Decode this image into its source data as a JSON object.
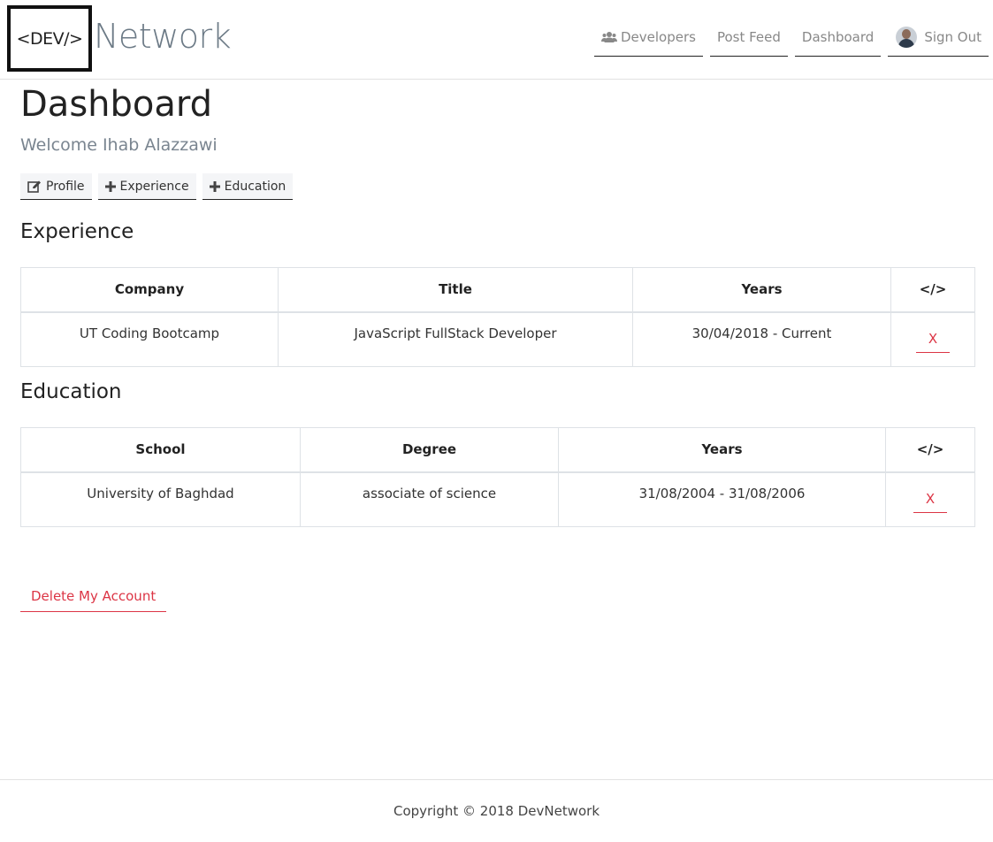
{
  "brand": {
    "logo_text": "<DEV/>",
    "name": "Network"
  },
  "nav": {
    "developers": "Developers",
    "post_feed": "Post Feed",
    "dashboard": "Dashboard",
    "sign_out": "Sign Out"
  },
  "page": {
    "title": "Dashboard",
    "welcome": "Welcome Ihab Alazzawi"
  },
  "actions": {
    "profile": "Profile",
    "experience": "Experience",
    "education": "Education"
  },
  "experience": {
    "heading": "Experience",
    "columns": [
      "Company",
      "Title",
      "Years",
      "</>"
    ],
    "rows": [
      {
        "company": "UT Coding Bootcamp",
        "title": "JavaScript FullStack Developer",
        "years": "30/04/2018 - Current",
        "delete_label": "X"
      }
    ]
  },
  "education": {
    "heading": "Education",
    "columns": [
      "School",
      "Degree",
      "Years",
      "</>"
    ],
    "rows": [
      {
        "school": "University of Baghdad",
        "degree": "associate of science",
        "years": "31/08/2004 - 31/08/2006",
        "delete_label": "X"
      }
    ]
  },
  "delete_account_label": "Delete My Account",
  "footer": {
    "copyright": "Copyright © 2018 DevNetwork"
  },
  "colors": {
    "danger": "#dc3545",
    "brand_muted": "#6c7a86"
  },
  "icons": {
    "developers": "users-icon",
    "profile": "edit-icon",
    "experience": "plus-icon",
    "education": "plus-icon"
  }
}
